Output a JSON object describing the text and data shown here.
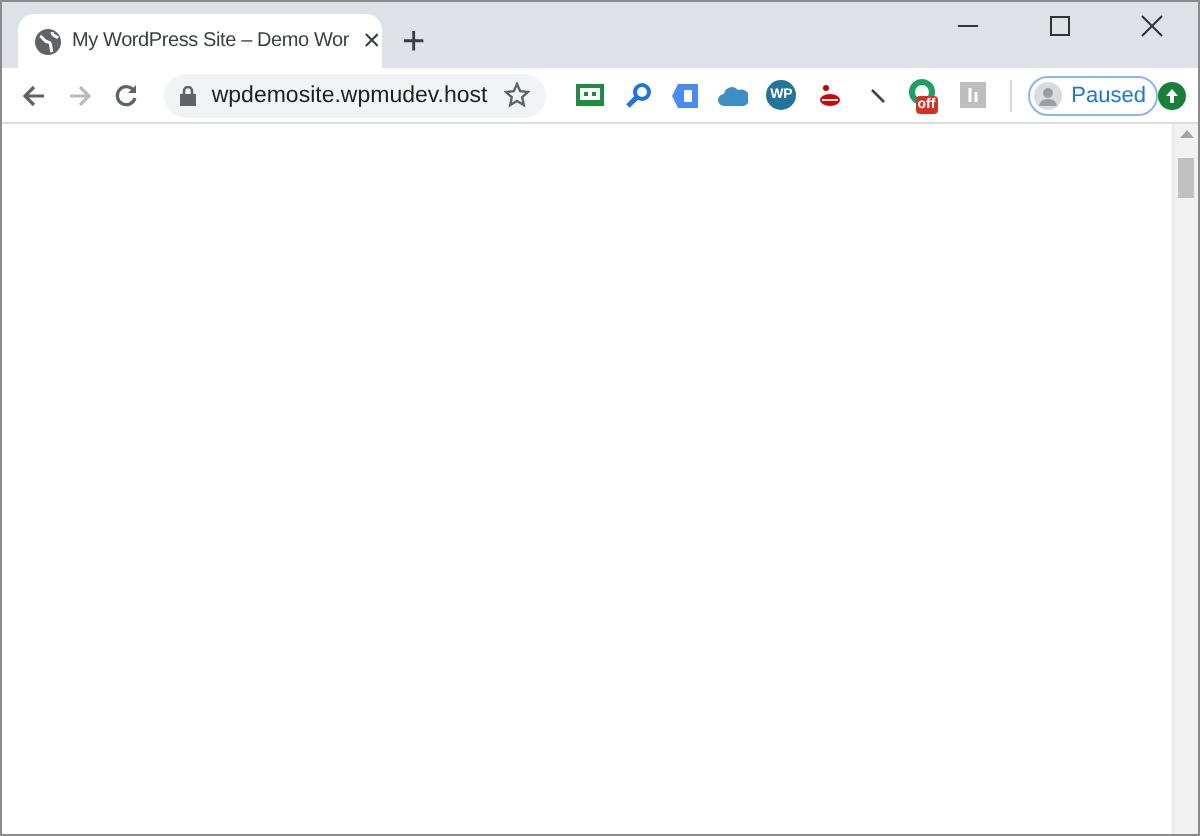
{
  "tabs": [
    {
      "title": "My WordPress Site – Demo Wor",
      "close": "×",
      "selected": true
    }
  ],
  "new_tab": "+",
  "toolbar": {
    "back_disabled": false,
    "forward_disabled": true,
    "url": "wpdemosite.wpmudev.host",
    "bookmarked": false
  },
  "extensions": [
    {
      "kind": "screen"
    },
    {
      "kind": "key"
    },
    {
      "kind": "tag"
    },
    {
      "kind": "cloud"
    },
    {
      "kind": "wp",
      "label": "WP"
    },
    {
      "kind": "lips"
    },
    {
      "kind": "slash"
    },
    {
      "kind": "ring",
      "badge": "off"
    },
    {
      "kind": "grey"
    }
  ],
  "profile": {
    "status": "Paused"
  },
  "update": {
    "kind": "green"
  }
}
